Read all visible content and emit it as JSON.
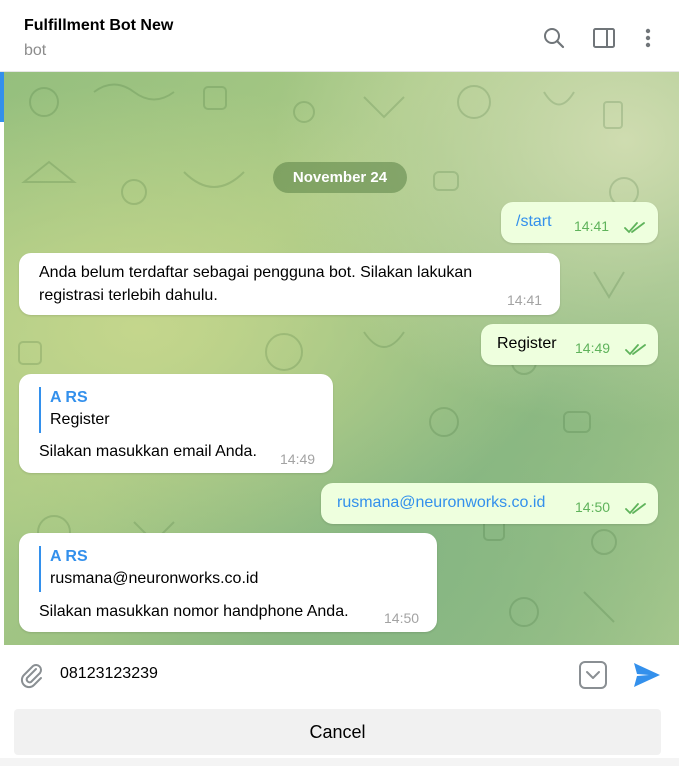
{
  "header": {
    "title": "Fulfillment Bot New",
    "subtitle": "bot",
    "icons": [
      "search-icon",
      "sidebar-toggle-icon",
      "more-vertical-icon"
    ]
  },
  "chat": {
    "date": "November 24",
    "messages": [
      {
        "direction": "out",
        "text": "/start",
        "time": "14:41",
        "status": "read"
      },
      {
        "direction": "in",
        "line1": "Anda belum terdaftar sebagai pengguna bot. Silakan lakukan",
        "line2": "registrasi terlebih dahulu.",
        "time": "14:41"
      },
      {
        "direction": "out",
        "text": "Register",
        "time": "14:49",
        "status": "read"
      },
      {
        "direction": "in",
        "reply_name": "A RS",
        "reply_text": "Register",
        "text": "Silakan masukkan email Anda.",
        "time": "14:49"
      },
      {
        "direction": "out",
        "text": "rusmana@neuronworks.co.id",
        "time": "14:50",
        "status": "read"
      },
      {
        "direction": "in",
        "reply_name": "A RS",
        "reply_text": "rusmana@neuronworks.co.id",
        "text": "Silakan masukkan nomor handphone Anda.",
        "time": "14:50"
      }
    ]
  },
  "composer": {
    "value": "08123123239",
    "cancel_label": "Cancel",
    "icons": [
      "paperclip-icon",
      "keyboard-toggle-icon",
      "send-icon"
    ]
  },
  "colors": {
    "accent": "#3390ec",
    "outgoing_bubble": "#eeffde",
    "read_check": "#5fb35b"
  }
}
